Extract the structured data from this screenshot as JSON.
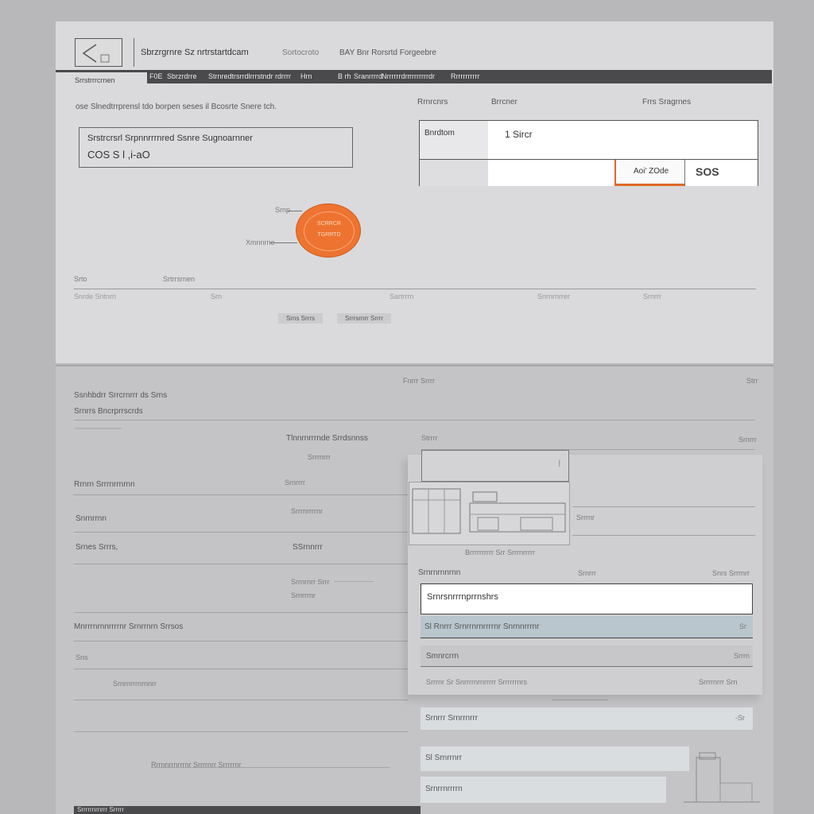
{
  "header": {
    "title_1": "Sbrzrgrnre",
    "title_2": "Sz nrtrstartdcam",
    "subtitle_mid": "Sortocroto",
    "subtitle_right": "BAY Bnr Rorsrtd Forgeebre"
  },
  "toolbar": {
    "left_tab": "Srrstrrrcrnen",
    "items": [
      "F0E",
      "Sbrzrdrre",
      "Strnredtrsrrdlrrrstndr rdrrrr",
      "Hrn",
      "B rh",
      "Sranrrrrd",
      "Nrrrrrrdrr",
      "rrrrrrrrdr",
      "Rrrrrrrrrrr"
    ]
  },
  "form": {
    "intro": "ose Slnedtrrprensl tdo borpen seses il Bcosrte Snere tch.",
    "summary_line_1": "Srstrcrsrl Srpnnrrrnred Ssnre Sugnoarnner",
    "summary_line_2": "COS S l   ,i-aO"
  },
  "right_table": {
    "col_1": "Rrnrcnrs",
    "col_2": "Brrcner",
    "col_3": "Frrs Sragrnes",
    "head_cell": "Bnrdtom",
    "value_1": "1 Sircr",
    "value_2": "Aoi' ZOde",
    "value_3": "SOS"
  },
  "badge": {
    "line_1": "SCRRCR",
    "line_2": "TGRRTD",
    "callout_top": "Srnp",
    "callout_left": "Xmnnrne"
  },
  "summary_table": {
    "head_1": "Srto",
    "head_2": "Srtrrsrnen",
    "row": [
      "Snrde  Sntnrn",
      "Srn",
      "Sartrrrn",
      "Snrnrnrrer",
      "Srnrrr"
    ],
    "btn_1": "Srns  Srrrs",
    "btn_2": "Srrrsrnrr Srrrr"
  },
  "lower": {
    "center_head": "Fnrrr Srrrr",
    "right_head": "Strr",
    "title": "Ssnhbdrr Srrcrnrrr ds Srns",
    "subtitle": "Srnrrs Bncrprrscrds",
    "section_label": "Tlnnrnrrrnde Srrdsnnss",
    "left_rows": [
      "Rrnrn Srrrnrrnrnn",
      "Snrnrrnn",
      "Srnes  Srrrs,",
      "Mnrrrnrnnrrrrnr Srnrrnrn Srrsos",
      "Sns",
      "Srnrnrrrnrnnrr"
    ],
    "mid_rows": [
      "Srrrnrrr",
      "Srnrrrr",
      "Srrrnrrrrnr",
      "SSrnnrrr",
      "Srrnrnrr  Srrr",
      "Srnrrrnr"
    ],
    "note_left": "Rrrnnrrnrrrnr  Srrrrnrr  Srrrrrnr"
  },
  "inner_window": {
    "head": "Strrrr",
    "right_head": "Srnrrr",
    "caption": "Brrrrrrrrrr  Srr  Srrrnrrrrr",
    "side_label": "Srrrnr",
    "list_head": "Srnrnrnnrnn",
    "list_head_mid": "Srnrrr",
    "list_head_right": "Snrs Srrrnrr",
    "items": [
      "Srnrsnrrrnprrnshrs",
      "Sl  Rnrrr Srnrrnrnrrrrnr  Snrnnrrrnr",
      "Smnrcrrn",
      "Srrrnr Sr Snrrrrnrnrrrrr Srrrrrrnrs"
    ],
    "item_2_right": "Sr",
    "item_3_right": "Srrrn",
    "item_4_right": "Srrrrnrrr Srn"
  },
  "lower_list": {
    "items": [
      "Srnrrr Srnrrnrrr",
      "Sl  Srnrrnrr",
      "Srnrrnrrrrn"
    ],
    "item_1_right": "-Sr"
  },
  "footer": {
    "text": "Srrrrrnrnrrr Srrrrr"
  },
  "colors": {
    "accent": "#ee7330",
    "dark_bar": "#4a4a4c",
    "panel": "#dadadc",
    "highlight_row": "#b9c6cd"
  }
}
